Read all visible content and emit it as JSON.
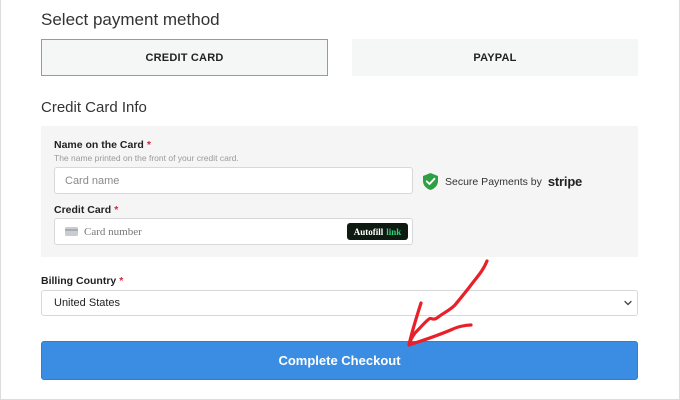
{
  "payment": {
    "title": "Select payment method",
    "tabs": [
      {
        "label": "CREDIT CARD",
        "selected": true
      },
      {
        "label": "PAYPAL",
        "selected": false
      }
    ]
  },
  "card_info": {
    "title": "Credit Card Info",
    "name_label": "Name on the Card",
    "name_required": "*",
    "name_hint": "The name printed on the front of your credit card.",
    "name_placeholder": "Card name",
    "card_label": "Credit Card",
    "card_required": "*",
    "card_placeholder": "Card number",
    "autofill_text": "Autofill",
    "autofill_link": "link",
    "secure_text": "Secure Payments by",
    "secure_brand": "stripe"
  },
  "billing": {
    "label": "Billing Country",
    "required": "*",
    "selected_country": "United States"
  },
  "checkout": {
    "button_label": "Complete Checkout"
  },
  "colors": {
    "accent": "#3a8de3",
    "selected_border": "#6aa4e6",
    "required": "#d7263d",
    "annotation_arrow": "#e8202a",
    "shield": "#2ea043"
  },
  "icons": {
    "shield": "shield-check-icon",
    "card": "credit-card-icon",
    "chevron": "chevron-down-icon",
    "arrow": "annotation-arrow"
  }
}
